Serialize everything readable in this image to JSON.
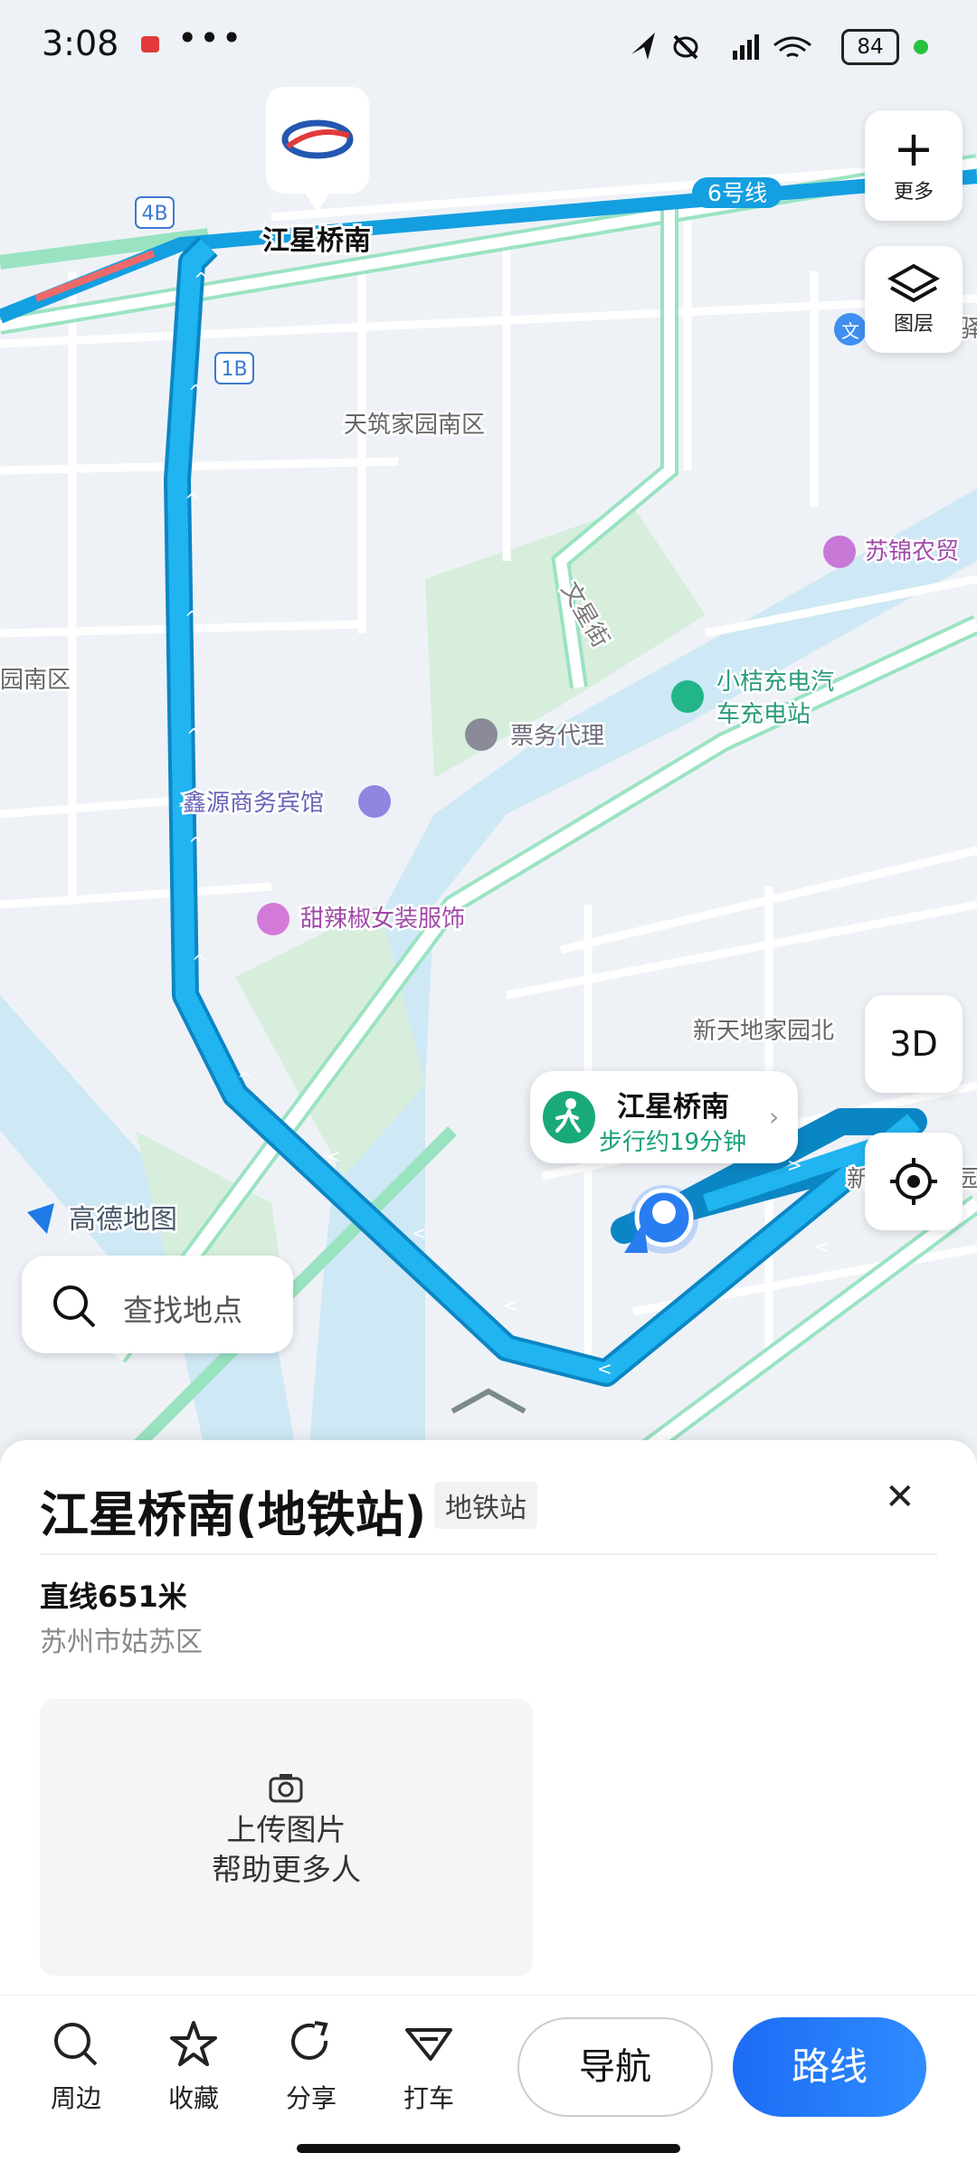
{
  "status_bar": {
    "time": "3:08",
    "dots": "•••",
    "battery": "84"
  },
  "map": {
    "line_label": "6号线",
    "exit_4b": "4B",
    "exit_1b": "1B",
    "station_label": "江星桥南",
    "watermark": "高德地图",
    "pois": [
      {
        "name": "天筑家园南区"
      },
      {
        "name": "苏锦农贸"
      },
      {
        "name": "文星街"
      },
      {
        "name": "小桔充电汽"
      },
      {
        "name": "车充电站"
      },
      {
        "name": "票务代理"
      },
      {
        "name": "鑫源商务宾馆"
      },
      {
        "name": "甜辣椒女装服饰"
      },
      {
        "name": "园南区"
      },
      {
        "name": "新天地家园北"
      },
      {
        "name": "新"
      },
      {
        "name": "园"
      },
      {
        "name": "驿"
      },
      {
        "name": "文"
      }
    ],
    "colors": {
      "route": "#1fb2ef",
      "road": "#ffffff",
      "green_edge": "#9ae3c1",
      "water": "#cfe8f5"
    }
  },
  "controls": {
    "more_label": "更多",
    "layers_label": "图层",
    "btn_3d": "3D",
    "search_placeholder": "查找地点"
  },
  "walk_pill": {
    "title": "江星桥南",
    "subtitle": "步行约19分钟"
  },
  "sheet": {
    "title": "江星桥南(地铁站)",
    "tag": "地铁站",
    "close": "✕",
    "distance": "直线651米",
    "address": "苏州市姑苏区",
    "upload_line1": "上传图片",
    "upload_line2": "帮助更多人"
  },
  "bottom_bar": {
    "tools": [
      {
        "label": "周边",
        "icon": "search-icon"
      },
      {
        "label": "收藏",
        "icon": "star-icon"
      },
      {
        "label": "分享",
        "icon": "share-icon"
      },
      {
        "label": "打车",
        "icon": "taxi-icon"
      }
    ],
    "navigate": "导航",
    "route": "路线"
  }
}
